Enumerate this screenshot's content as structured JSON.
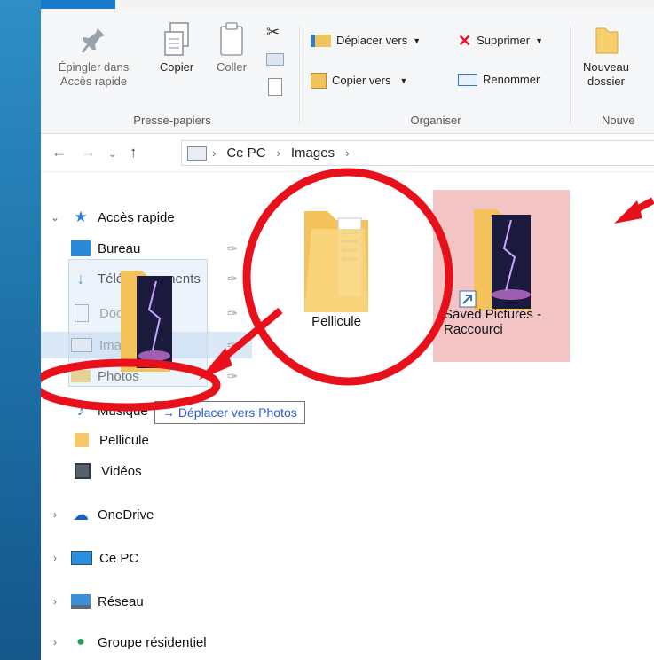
{
  "ribbon": {
    "pin_label_1": "Épingler dans",
    "pin_label_2": "Accès rapide",
    "copy_label": "Copier",
    "paste_label": "Coller",
    "move_label": "Déplacer vers",
    "copyto_label": "Copier vers",
    "delete_label": "Supprimer",
    "rename_label": "Renommer",
    "newfolder_label_1": "Nouveau",
    "newfolder_label_2": "dossier",
    "group_clipboard": "Presse-papiers",
    "group_organize": "Organiser",
    "group_new": "Nouve"
  },
  "address": {
    "crumbs": [
      "Ce PC",
      "Images"
    ]
  },
  "nav": {
    "quick_access": "Accès rapide",
    "items": [
      {
        "label": "Bureau",
        "pinned": true
      },
      {
        "label": "Téléchargements",
        "pinned": true
      },
      {
        "label": "Documents",
        "pinned": true
      },
      {
        "label": "Images",
        "pinned": true
      },
      {
        "label": "Photos",
        "pinned": true
      },
      {
        "label": "Musique",
        "pinned": false
      },
      {
        "label": "Pellicule",
        "pinned": false
      },
      {
        "label": "Vidéos",
        "pinned": false
      }
    ],
    "onedrive": "OneDrive",
    "thispc": "Ce PC",
    "network": "Réseau",
    "homegroup": "Groupe résidentiel"
  },
  "content": {
    "folder1": "Pellicule",
    "folder2_line1": "Saved Pictures -",
    "folder2_line2": "Raccourci"
  },
  "drag": {
    "tooltip": "→ Déplacer vers Photos"
  },
  "colors": {
    "accent": "#1979ca",
    "annotation": "#e8111b",
    "selection": "#f3c4c4"
  }
}
